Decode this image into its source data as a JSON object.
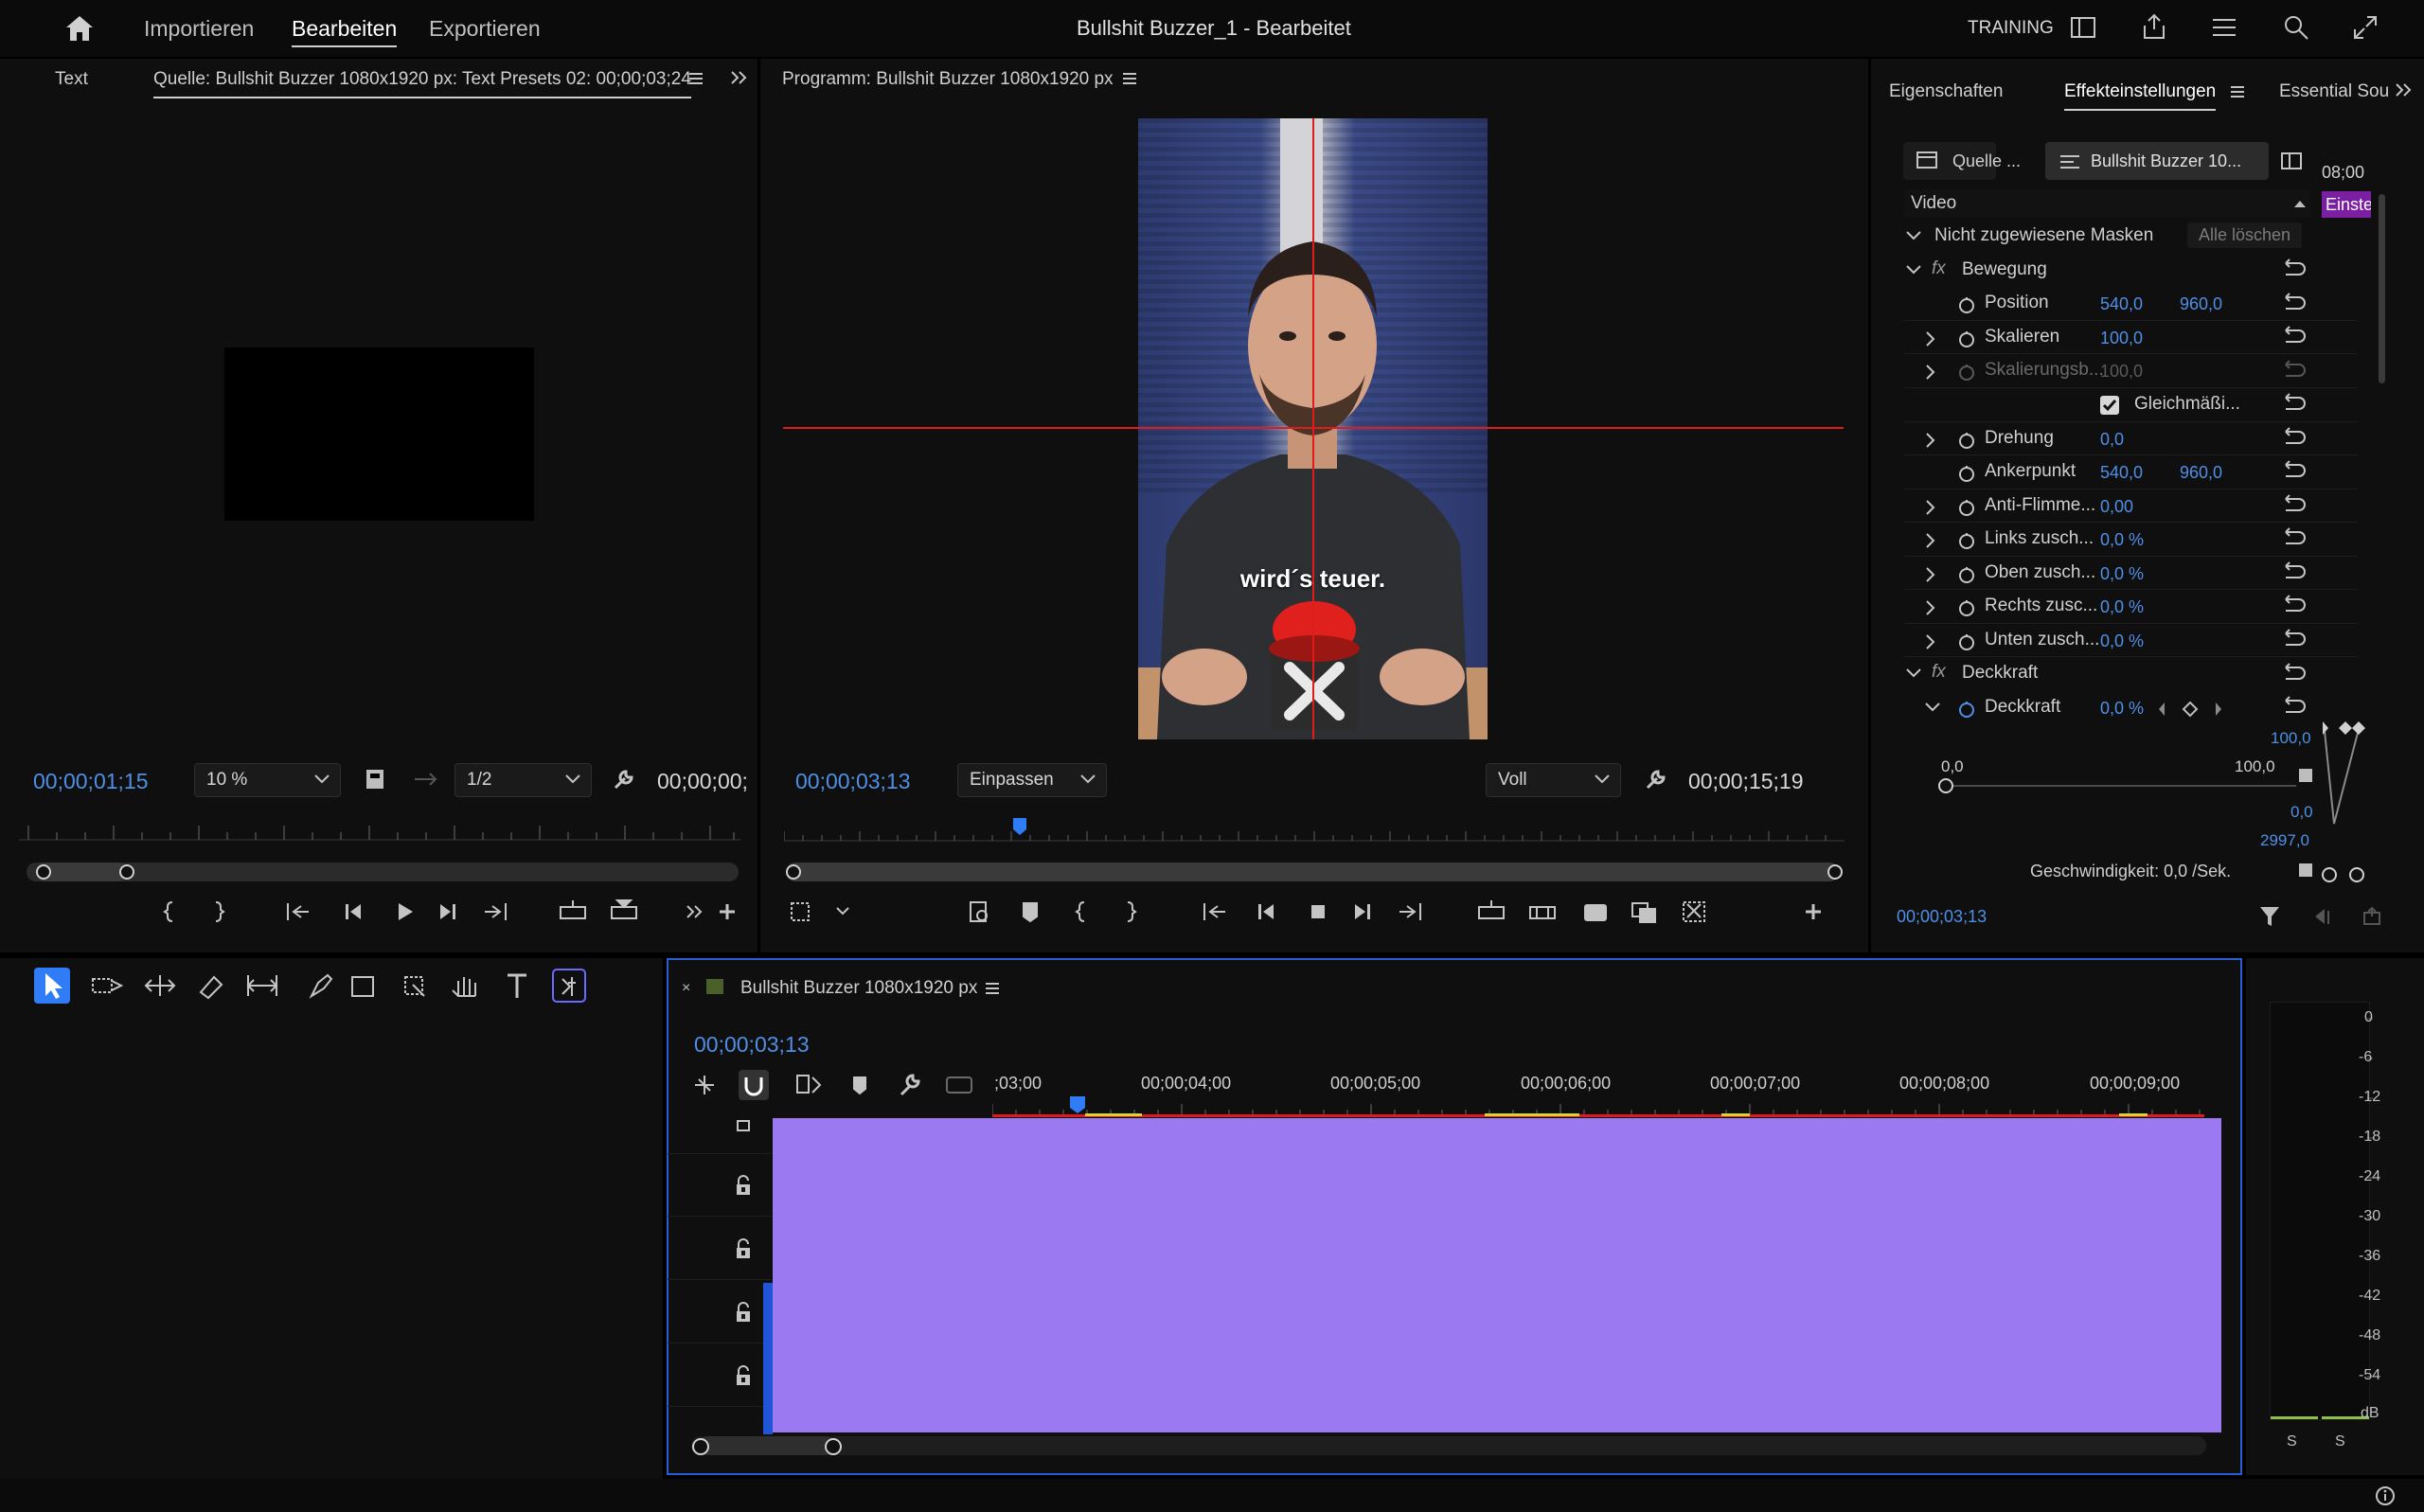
{
  "topbar": {
    "nav": [
      "Importieren",
      "Bearbeiten",
      "Exportieren"
    ],
    "title": "Bullshit Buzzer_1 - Bearbeitet",
    "workspace": "TRAINING"
  },
  "source_monitor": {
    "tab_text": "Text",
    "tab_source": "Quelle: Bullshit Buzzer 1080x1920 px: Text Presets 02: 00;00;03;24",
    "timecode": "00;00;01;15",
    "zoom": "10 %",
    "resolution": "1/2",
    "duration_timecode": "00;00;00;"
  },
  "program_monitor": {
    "tab": "Programm: Bullshit Buzzer 1080x1920 px",
    "timecode": "00;00;03;13",
    "fit": "Einpassen",
    "quality": "Voll",
    "duration": "00;00;15;19",
    "caption": "wird´s teuer."
  },
  "effects_panel": {
    "tabs": [
      "Eigenschaften",
      "Effekteinstellungen",
      "Essential Sou"
    ],
    "source_btn": "Quelle ...",
    "sequence_btn": "Bullshit Buzzer 10...",
    "mini_timecode": "08;00",
    "mini_clip": "Einste",
    "section_video": "Video",
    "masks_label": "Nicht zugewiesene Masken",
    "masks_btn": "Alle löschen",
    "fx_motion": "Bewegung",
    "rows": {
      "position": {
        "label": "Position",
        "v1": "540,0",
        "v2": "960,0"
      },
      "scale": {
        "label": "Skalieren",
        "v1": "100,0"
      },
      "scale_width": {
        "label": "Skalierungsb...",
        "v1": "100,0"
      },
      "uniform": {
        "label": "Gleichmäßi..."
      },
      "rotation": {
        "label": "Drehung",
        "v1": "0,0"
      },
      "anchor": {
        "label": "Ankerpunkt",
        "v1": "540,0",
        "v2": "960,0"
      },
      "antiflicker": {
        "label": "Anti-Flimme...",
        "v1": "0,00"
      },
      "crop_left": {
        "label": "Links zusch...",
        "v1": "0,0 %"
      },
      "crop_top": {
        "label": "Oben zusch...",
        "v1": "0,0 %"
      },
      "crop_right": {
        "label": "Rechts zusc...",
        "v1": "0,0 %"
      },
      "crop_bottom": {
        "label": "Unten zusch...",
        "v1": "0,0 %"
      }
    },
    "fx_opacity": "Deckkraft",
    "opacity_row": {
      "label": "Deckkraft",
      "v1": "0,0 %"
    },
    "graph": {
      "max": "100,0",
      "min_left": "0,0",
      "max_right": "100,0",
      "zero": "0,0",
      "speed_max": "2997,0",
      "speed": "Geschwindigkeit: 0,0 /Sek."
    },
    "footer_timecode": "00;00;03;13"
  },
  "timeline": {
    "sequence_name": "Bullshit Buzzer 1080x1920 px",
    "timecode": "00;00;03;13",
    "ruler": [
      ";03;00",
      "00;00;04;00",
      "00;00;05;00",
      "00;00;06;00",
      "00;00;07;00",
      "00;00;08;00",
      "00;00;09;00"
    ]
  },
  "audio_meter": {
    "scale": [
      "0",
      "-6",
      "-12",
      "-18",
      "-24",
      "-30",
      "-36",
      "-42",
      "-48",
      "-54",
      "dB"
    ],
    "solo": [
      "S",
      "S"
    ]
  },
  "colors": {
    "accent": "#4f8fe6",
    "clip": "#9b79f0",
    "guide": "#e01b1b",
    "panel_bg": "#0f0f0f"
  }
}
